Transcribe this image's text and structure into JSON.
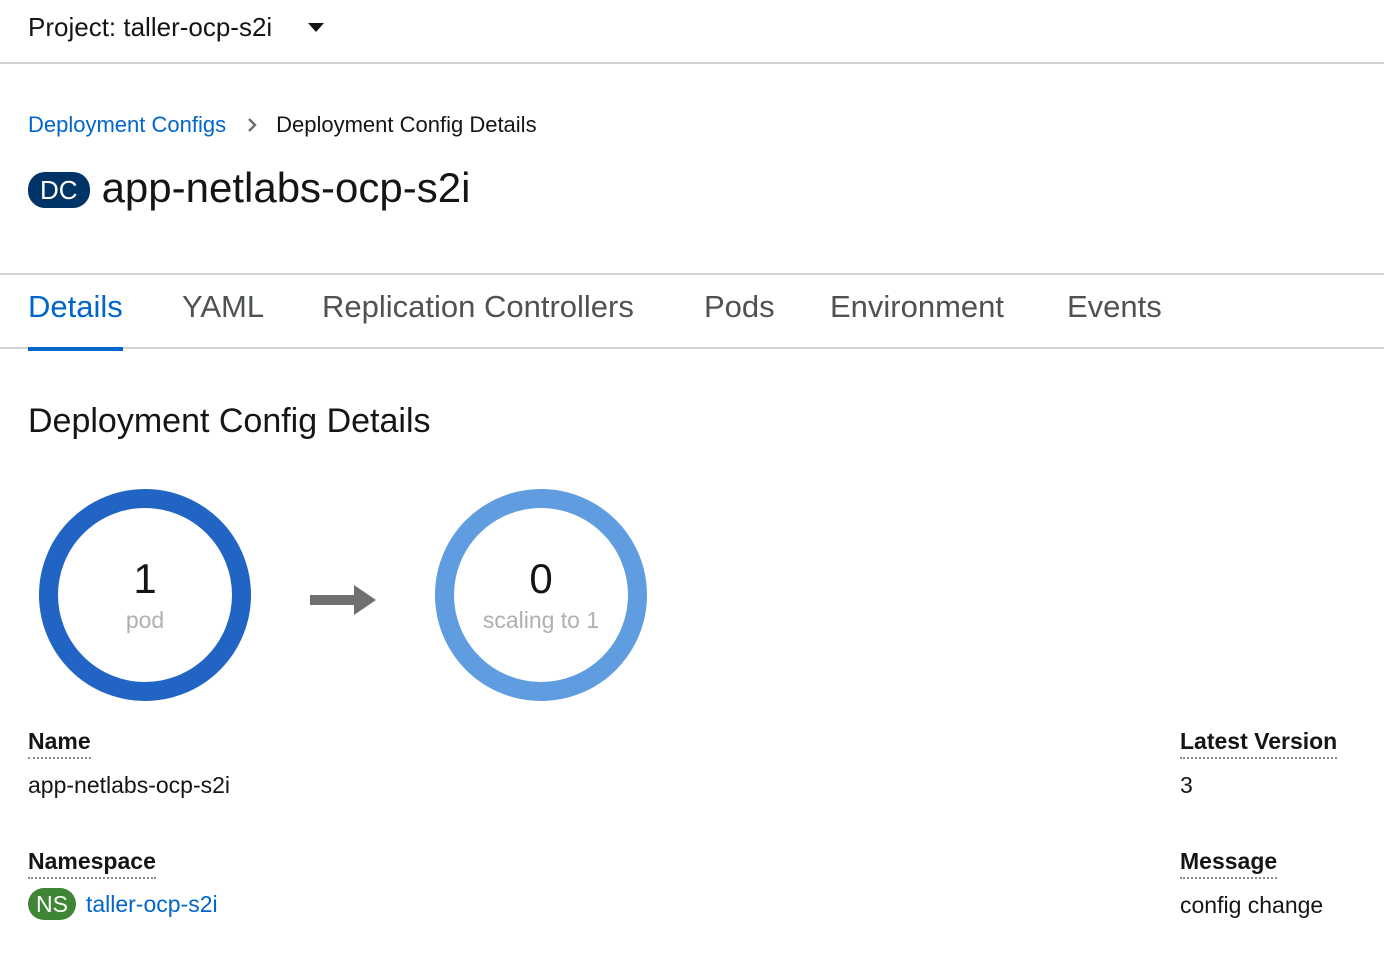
{
  "project": {
    "label": "Project: taller-ocp-s2i"
  },
  "breadcrumb": {
    "parent": "Deployment Configs",
    "current": "Deployment Config Details"
  },
  "resource": {
    "badge": "DC",
    "name": "app-netlabs-ocp-s2i"
  },
  "tabs": [
    {
      "label": "Details",
      "active": true
    },
    {
      "label": "YAML"
    },
    {
      "label": "Replication Controllers"
    },
    {
      "label": "Pods"
    },
    {
      "label": "Environment"
    },
    {
      "label": "Events"
    }
  ],
  "section": {
    "heading": "Deployment Config Details"
  },
  "pods": {
    "current": {
      "count": "1",
      "label": "pod",
      "ring_color": "#2264c4"
    },
    "target": {
      "count": "0",
      "label": "scaling to 1",
      "ring_color": "#5f9de0"
    },
    "arrow_color": "#707070"
  },
  "details": {
    "name": {
      "term": "Name",
      "value": "app-netlabs-ocp-s2i"
    },
    "namespace": {
      "term": "Namespace",
      "badge": "NS",
      "value": "taller-ocp-s2i"
    },
    "latest_version": {
      "term": "Latest Version",
      "value": "3"
    },
    "message": {
      "term": "Message",
      "value": "config change"
    }
  },
  "colors": {
    "link": "#0066cc",
    "dc_badge": "#003366",
    "ns_badge": "#3e8635"
  }
}
